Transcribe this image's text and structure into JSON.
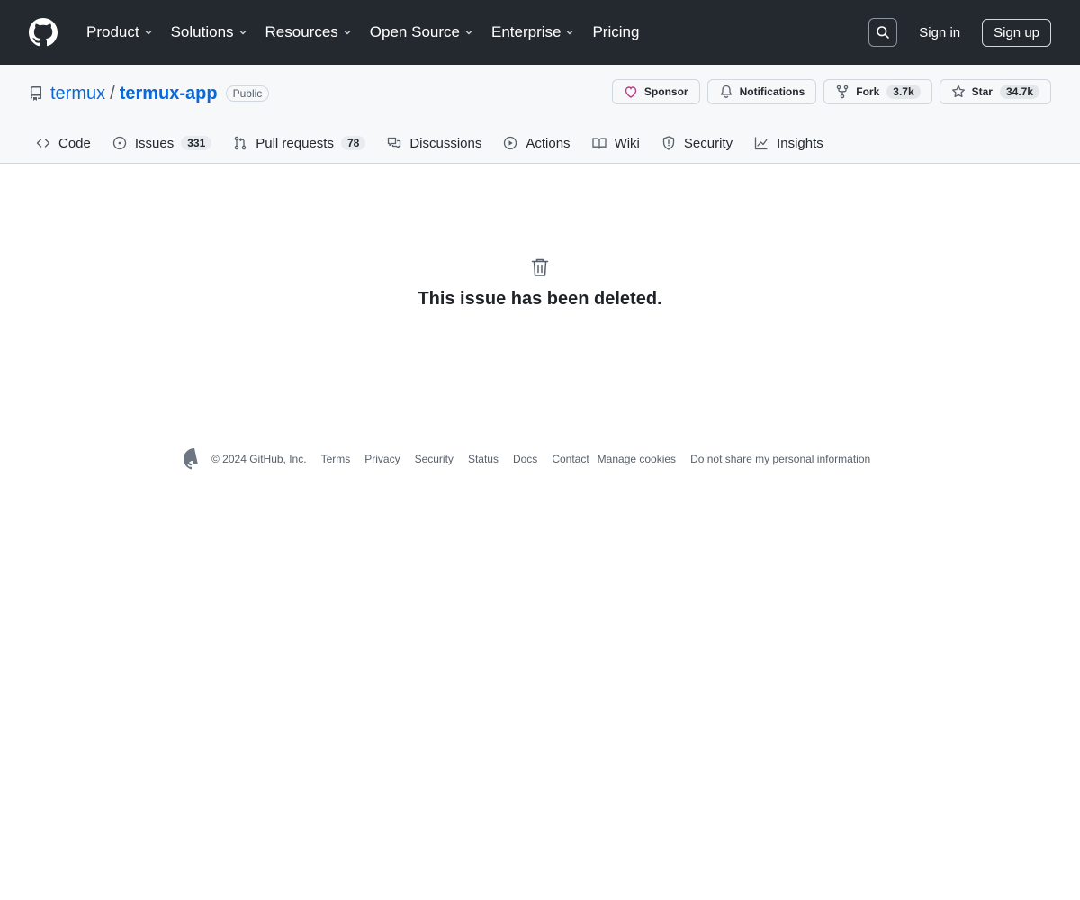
{
  "header": {
    "nav": [
      {
        "label": "Product",
        "has_menu": true
      },
      {
        "label": "Solutions",
        "has_menu": true
      },
      {
        "label": "Resources",
        "has_menu": true
      },
      {
        "label": "Open Source",
        "has_menu": true
      },
      {
        "label": "Enterprise",
        "has_menu": true
      },
      {
        "label": "Pricing",
        "has_menu": false
      }
    ],
    "search_icon": "search-icon",
    "signin_label": "Sign in",
    "signup_label": "Sign up"
  },
  "repo": {
    "owner": "termux",
    "separator": "/",
    "name": "termux-app",
    "visibility": "Public",
    "actions": {
      "sponsor_label": "Sponsor",
      "notifications_label": "Notifications",
      "fork_label": "Fork",
      "fork_count": "3.7k",
      "star_label": "Star",
      "star_count": "34.7k"
    },
    "tabs": [
      {
        "label": "Code",
        "icon": "code-icon"
      },
      {
        "label": "Issues",
        "icon": "issue-icon",
        "count": "331"
      },
      {
        "label": "Pull requests",
        "icon": "pull-request-icon",
        "count": "78"
      },
      {
        "label": "Discussions",
        "icon": "discussions-icon"
      },
      {
        "label": "Actions",
        "icon": "actions-icon"
      },
      {
        "label": "Wiki",
        "icon": "wiki-icon"
      },
      {
        "label": "Security",
        "icon": "shield-icon"
      },
      {
        "label": "Insights",
        "icon": "graph-icon"
      }
    ]
  },
  "main": {
    "icon": "trash-icon",
    "message": "This issue has been deleted."
  },
  "footer": {
    "copyright": "© 2024 GitHub, Inc.",
    "links": [
      "Terms",
      "Privacy",
      "Security",
      "Status",
      "Docs",
      "Contact",
      "Manage cookies",
      "Do not share my personal information"
    ]
  },
  "colors": {
    "topbar_bg": "#24292f",
    "repohead_bg": "#f6f8fa",
    "link_blue": "#0969da",
    "sponsor_pink": "#bf3989"
  }
}
